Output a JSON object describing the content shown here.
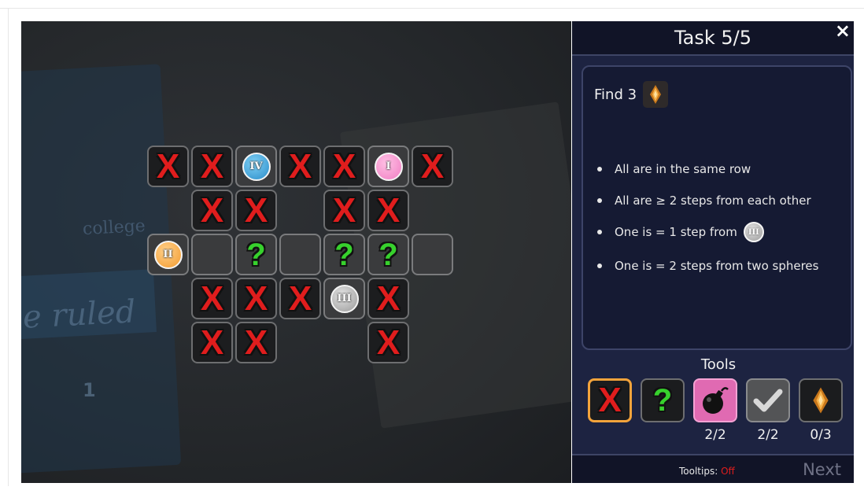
{
  "panel": {
    "title": "Task 5/5",
    "close_label": "×",
    "find_label": "Find 3",
    "find_icon": "amber-gem-icon",
    "clues": [
      "All are in the same row",
      "All are ≥ 2 steps from each other",
      "One is = 1 step from",
      "One is = 2 steps from two spheres"
    ],
    "clue_sphere_label": "III",
    "tools_label": "Tools",
    "tools": [
      {
        "name": "x-mark-tool",
        "icon": "x-mark-icon",
        "count": ""
      },
      {
        "name": "question-mark-tool",
        "icon": "question-mark-icon",
        "count": ""
      },
      {
        "name": "bomb-tool",
        "icon": "bomb-icon",
        "count": "2/2"
      },
      {
        "name": "check-tool",
        "icon": "checkmark-icon",
        "count": "2/2"
      },
      {
        "name": "gem-tool",
        "icon": "amber-gem-icon",
        "count": "0/3"
      }
    ],
    "tooltips_label": "Tooltips:",
    "tooltips_value": "Off",
    "next_label": "Next"
  },
  "board": {
    "background_text": [
      "college",
      "e ruled",
      "1"
    ],
    "x_glyph": "X",
    "q_glyph": "?",
    "sphere_labels": [
      "IV",
      "I",
      "II",
      "III"
    ],
    "colors": {
      "x_mark": "#e01d1d",
      "question_mark": "#37d12d",
      "sphere_iv": "#2a8cc9",
      "sphere_i": "#f07cc2",
      "sphere_ii": "#f39a2e",
      "sphere_iii": "#9a9a9a",
      "selected_tool_border": "#f3a33b",
      "tooltips_off": "#e01d1d"
    },
    "rows": [
      [
        "X",
        "X",
        "sphere-IV",
        "X",
        "X",
        "sphere-I",
        "X"
      ],
      [
        null,
        "X",
        "X",
        null,
        "X",
        "X",
        null
      ],
      [
        "sphere-II",
        "empty",
        "?",
        "empty",
        "?",
        "?",
        "empty"
      ],
      [
        null,
        "X",
        "X",
        "X",
        "sphere-III",
        "X",
        null
      ],
      [
        null,
        "X",
        "X",
        null,
        null,
        "X",
        null
      ]
    ]
  }
}
